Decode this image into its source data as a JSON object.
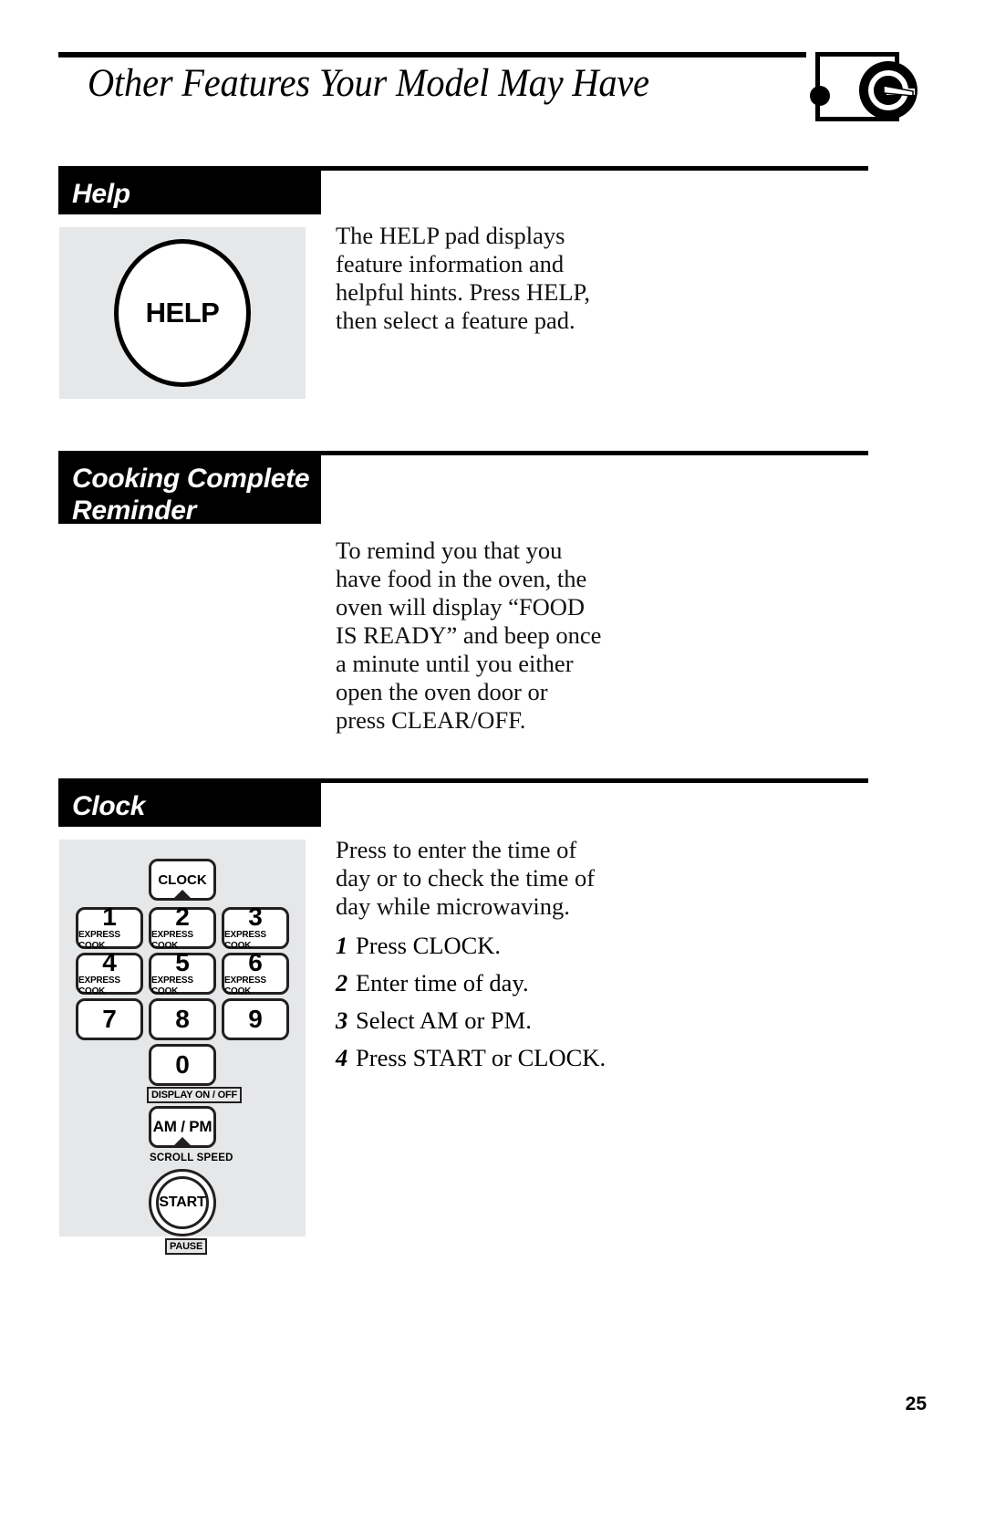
{
  "header": {
    "title": "Other Features Your Model May Have",
    "logo_name": "ge-logo"
  },
  "sections": [
    {
      "id": "help",
      "bar_label": "Help",
      "body": "The HELP pad displays feature information and helpful hints. Press HELP, then select a feature pad.",
      "illustration": {
        "pad_label": "HELP"
      }
    },
    {
      "id": "cooking-complete-reminder",
      "bar_label": "Cooking Complete\nReminder",
      "body": "To remind you that you have food in the oven, the oven will display “FOOD IS READY” and beep once a minute until you either open the oven door or press CLEAR/OFF."
    },
    {
      "id": "clock",
      "bar_label": "Clock",
      "body": "Press to enter the time of day or to check the time of day while microwaving.",
      "steps": [
        {
          "num": "1",
          "text": "Press CLOCK."
        },
        {
          "num": "2",
          "text": "Enter time of day."
        },
        {
          "num": "3",
          "text": "Select AM or PM."
        },
        {
          "num": "4",
          "text": "Press START or CLOCK."
        }
      ]
    }
  ],
  "keypad": {
    "clock_key": "CLOCK",
    "keys": [
      {
        "digit": "1",
        "sub": "EXPRESS COOK"
      },
      {
        "digit": "2",
        "sub": "EXPRESS COOK"
      },
      {
        "digit": "3",
        "sub": "EXPRESS COOK"
      },
      {
        "digit": "4",
        "sub": "EXPRESS COOK"
      },
      {
        "digit": "5",
        "sub": "EXPRESS COOK"
      },
      {
        "digit": "6",
        "sub": "EXPRESS COOK"
      },
      {
        "digit": "7",
        "sub": ""
      },
      {
        "digit": "8",
        "sub": ""
      },
      {
        "digit": "9",
        "sub": ""
      }
    ],
    "zero_key": "0",
    "display_on_off_label": "DISPLAY ON / OFF",
    "am_pm_key": "AM / PM",
    "scroll_speed_label": "SCROLL SPEED",
    "start_key": "START",
    "pause_label": "PAUSE"
  },
  "footer": {
    "page_number": "25"
  },
  "colors": {
    "bar_background": "#000000",
    "bar_text": "#ffffff",
    "panel_background": "#e6e7e8",
    "key_border": "#231f20"
  }
}
